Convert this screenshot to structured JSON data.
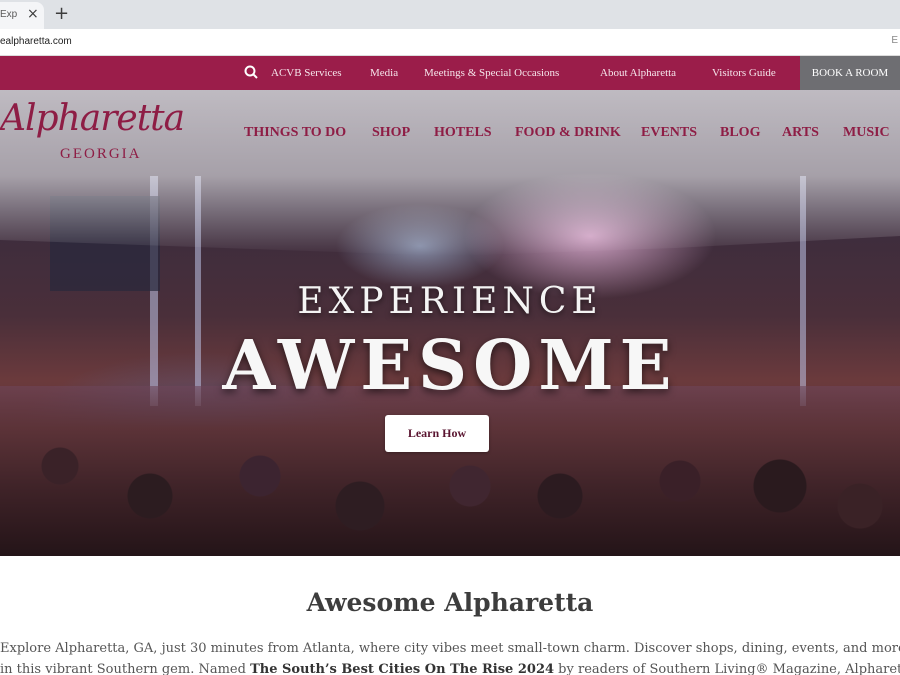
{
  "browser": {
    "tab_title": "Exp",
    "tab_close": "×",
    "new_tab": "+",
    "url": "ealpharetta.com",
    "addr_right": "E"
  },
  "utility_nav": {
    "links": [
      "ACVB Services",
      "Media",
      "Meetings & Special Occasions",
      "About Alpharetta",
      "Visitors Guide"
    ],
    "book_label": "BOOK A ROOM"
  },
  "logo": {
    "script": "Alpharetta",
    "sub": "GEORGIA"
  },
  "main_nav": [
    "THINGS TO DO",
    "SHOP",
    "HOTELS",
    "FOOD & DRINK",
    "EVENTS",
    "BLOG",
    "ARTS",
    "MUSIC"
  ],
  "hero": {
    "headline_top": "EXPERIENCE",
    "headline_main": "AWESOME",
    "cta_label": "Learn How"
  },
  "intro": {
    "title": "Awesome Alpharetta",
    "line1": "Explore Alpharetta, GA, just 30 minutes from Atlanta, where city vibes meet small-town charm. Discover shops, dining, events, and more",
    "line2_pre": "in this vibrant Southern gem. Named ",
    "line2_bold": "The South’s Best Cities On The Rise 2024",
    "line2_post": " by readers of Southern Living® Magazine, Alpharetta"
  },
  "colors": {
    "brand": "#9b1d4a",
    "brand_text": "#8e1d45",
    "book_button": "#6e6e72"
  }
}
